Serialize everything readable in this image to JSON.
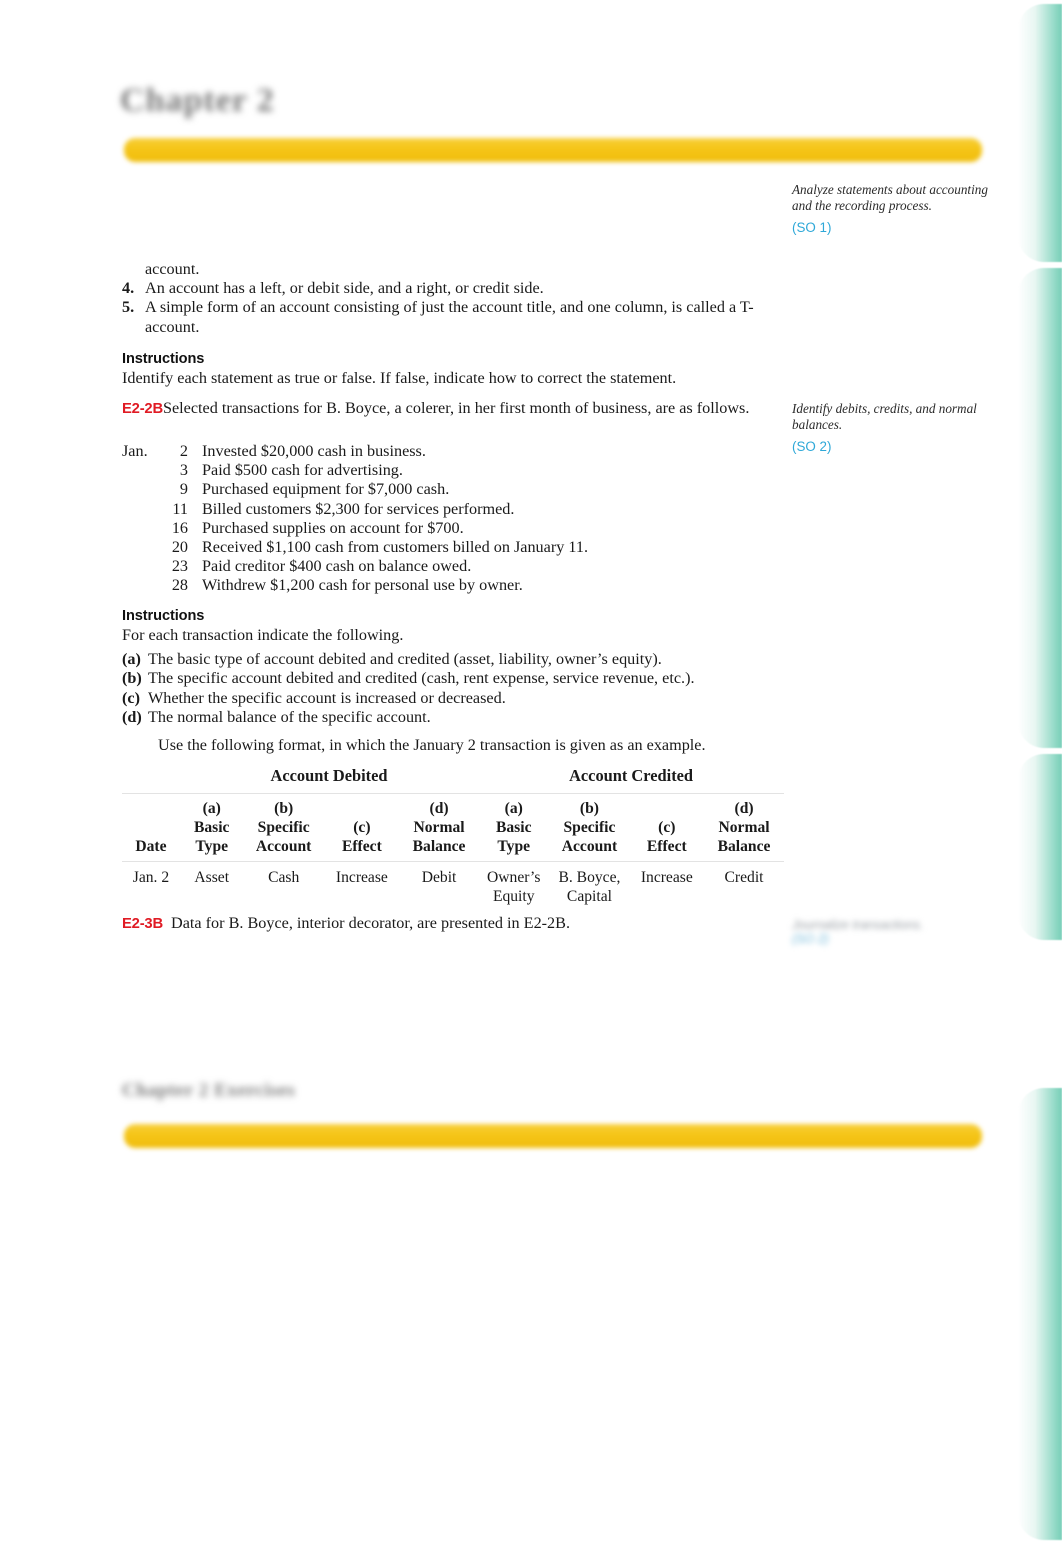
{
  "page": {
    "running_head": "Chapter 2",
    "footer_head": "Chapter 2  Exercises"
  },
  "decor": {
    "tab_color": "#88d6c1",
    "gold_bar_color": "#f5c518",
    "accent_red": "#e01b24",
    "accent_blue": "#2ea8d8"
  },
  "tail": {
    "continued_word": "account."
  },
  "numbered_statements": [
    {
      "num": "4.",
      "text": "An account has a left, or debit side, and a right, or credit side."
    },
    {
      "num": "5.",
      "text": "A simple form of an account consisting of just the account title, and one column, is called a T-account."
    }
  ],
  "instructions_1": {
    "heading": "Instructions",
    "body": "Identify each statement as true or false. If false, indicate how to correct the statement."
  },
  "exercise_2b": {
    "code": "E2-2B",
    "intro": "Selected transactions for B. Boyce, a colerer, in her first month of business, are as follows.",
    "transactions": [
      {
        "month": "Jan.",
        "day": "2",
        "desc": "Invested $20,000 cash in business."
      },
      {
        "month": "",
        "day": "3",
        "desc": "Paid $500 cash for advertising."
      },
      {
        "month": "",
        "day": "9",
        "desc": "Purchased equipment for $7,000 cash."
      },
      {
        "month": "",
        "day": "11",
        "desc": "Billed customers $2,300 for services performed."
      },
      {
        "month": "",
        "day": "16",
        "desc": "Purchased supplies on account for $700."
      },
      {
        "month": "",
        "day": "20",
        "desc": "Received $1,100 cash from customers billed on January 11."
      },
      {
        "month": "",
        "day": "23",
        "desc": "Paid creditor $400 cash on balance owed."
      },
      {
        "month": "",
        "day": "28",
        "desc": "Withdrew $1,200 cash for personal use by owner."
      }
    ]
  },
  "instructions_2": {
    "heading": "Instructions",
    "body": "For each transaction indicate the following.",
    "items": [
      {
        "label": "(a)",
        "text": "The basic type of account debited and credited (asset, liability, owner’s equity)."
      },
      {
        "label": "(b)",
        "text": "The specific account debited and credited (cash, rent expense, service revenue, etc.)."
      },
      {
        "label": "(c)",
        "text": "Whether the specific account is increased or decreased."
      },
      {
        "label": "(d)",
        "text": "The normal balance of the specific account."
      }
    ],
    "note": "Use the following format, in which the January 2 transaction is given as an example."
  },
  "format_table": {
    "group_headers": [
      {
        "label": "",
        "span": 1
      },
      {
        "label": "Account Debited",
        "span": 4
      },
      {
        "label": "Account Credited",
        "span": 4
      }
    ],
    "columns": [
      {
        "letter": "",
        "line1": "",
        "line2": "Date"
      },
      {
        "letter": "(a)",
        "line1": "Basic",
        "line2": "Type"
      },
      {
        "letter": "(b)",
        "line1": "Specific",
        "line2": "Account"
      },
      {
        "letter": "(c)",
        "line1": "",
        "line2": "Effect"
      },
      {
        "letter": "(d)",
        "line1": "Normal",
        "line2": "Balance"
      },
      {
        "letter": "(a)",
        "line1": "Basic",
        "line2": "Type"
      },
      {
        "letter": "(b)",
        "line1": "Specific",
        "line2": "Account"
      },
      {
        "letter": "(c)",
        "line1": "",
        "line2": "Effect"
      },
      {
        "letter": "(d)",
        "line1": "Normal",
        "line2": "Balance"
      }
    ],
    "rows": [
      {
        "date": {
          "l1": "Jan. 2",
          "l2": ""
        },
        "d_basic": {
          "l1": "Asset",
          "l2": ""
        },
        "d_specific": {
          "l1": "Cash",
          "l2": ""
        },
        "d_effect": {
          "l1": "Increase",
          "l2": ""
        },
        "d_normal": {
          "l1": "Debit",
          "l2": ""
        },
        "c_basic": {
          "l1": "Owner’s",
          "l2": "Equity"
        },
        "c_specific": {
          "l1": "B. Boyce,",
          "l2": "Capital"
        },
        "c_effect": {
          "l1": "Increase",
          "l2": ""
        },
        "c_normal": {
          "l1": "Credit",
          "l2": ""
        }
      }
    ]
  },
  "exercise_3b": {
    "code": "E2-3B",
    "text": "Data for B. Boyce, interior decorator, are presented in E2-2B."
  },
  "margin_notes": [
    {
      "text": "Analyze statements about accounting and the recording process.",
      "so": "(SO 1)"
    },
    {
      "text": "Identify debits, credits, and normal balances.",
      "so": "(SO 2)"
    }
  ],
  "margin_note_obscured": {
    "text": "Journalize transactions.",
    "so": "(SO 2)"
  }
}
